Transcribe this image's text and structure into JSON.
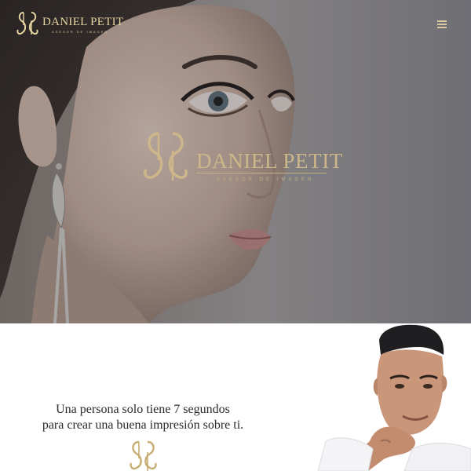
{
  "header": {
    "brand": "DANIEL PETIT",
    "tagline": "ASESOR DE IMAGEN",
    "menu_icon": "hamburger-menu-icon"
  },
  "hero": {
    "logo_brand": "DANIEL PETIT",
    "logo_tagline": "ASESOR DE IMAGEN",
    "logo_icon": "dp-monogram-icon"
  },
  "intro": {
    "quote_line1": "Una persona solo tiene 7 segundos",
    "quote_line2": "para crear una buena impresión sobre ti.",
    "monogram_icon": "dp-monogram-icon"
  },
  "colors": {
    "gold": "#cdb78a",
    "text": "#2a2a2a"
  }
}
